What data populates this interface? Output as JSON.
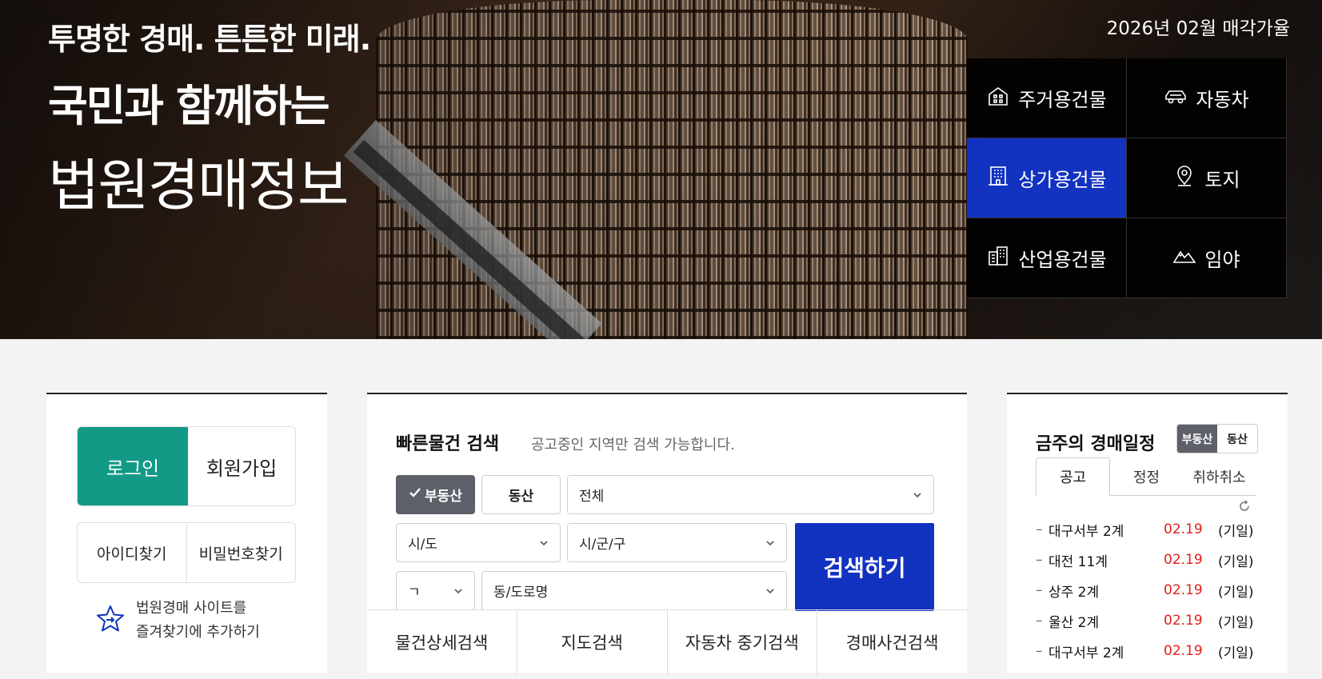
{
  "hero": {
    "line1": "투명한 경매. 튼튼한 미래.",
    "line2": "국민과 함께하는",
    "line3": "법원경매정보",
    "date_label": "2026년 02월 매각가율"
  },
  "categories": [
    {
      "label": "주거용건물",
      "icon": "house-icon",
      "active": false
    },
    {
      "label": "자동차",
      "icon": "car-icon",
      "active": false
    },
    {
      "label": "상가용건물",
      "icon": "building-icon",
      "active": true
    },
    {
      "label": "토지",
      "icon": "map-pin-icon",
      "active": false
    },
    {
      "label": "산업용건물",
      "icon": "factory-icon",
      "active": false
    },
    {
      "label": "임야",
      "icon": "mountain-icon",
      "active": false
    }
  ],
  "login": {
    "login_label": "로그인",
    "join_label": "회원가입",
    "find_id_label": "아이디찾기",
    "find_pw_label": "비밀번호찾기",
    "fav_line1": "법원경매 사이트를",
    "fav_line2": "즐겨찾기에 추가하기"
  },
  "search": {
    "title": "빠른물건 검색",
    "subtitle": "공고중인 지역만 검색 가능합니다.",
    "type_realestate": "부동산",
    "type_movable": "동산",
    "category_value": "전체",
    "sido_value": "시/도",
    "sigungu_value": "시/군/구",
    "initial_value": "ㄱ",
    "dong_value": "동/도로명",
    "search_button": "검색하기",
    "bottom_tabs": [
      "물건상세검색",
      "지도검색",
      "자동차 중기검색",
      "경매사건검색"
    ]
  },
  "schedule": {
    "title": "금주의 경매일정",
    "toggle_realestate": "부동산",
    "toggle_movable": "동산",
    "tabs": [
      "공고",
      "정정",
      "취하취소"
    ],
    "items": [
      {
        "court": "대구서부 2계",
        "date": "02.19",
        "state": "(기일)"
      },
      {
        "court": "대전 11계",
        "date": "02.19",
        "state": "(기일)"
      },
      {
        "court": "상주 2계",
        "date": "02.19",
        "state": "(기일)"
      },
      {
        "court": "울산 2계",
        "date": "02.19",
        "state": "(기일)"
      },
      {
        "court": "대구서부 2계",
        "date": "02.19",
        "state": "(기일)"
      }
    ]
  },
  "colors": {
    "brand_blue": "#1232c0",
    "login_green": "#129a87",
    "date_red": "#e0201b"
  }
}
